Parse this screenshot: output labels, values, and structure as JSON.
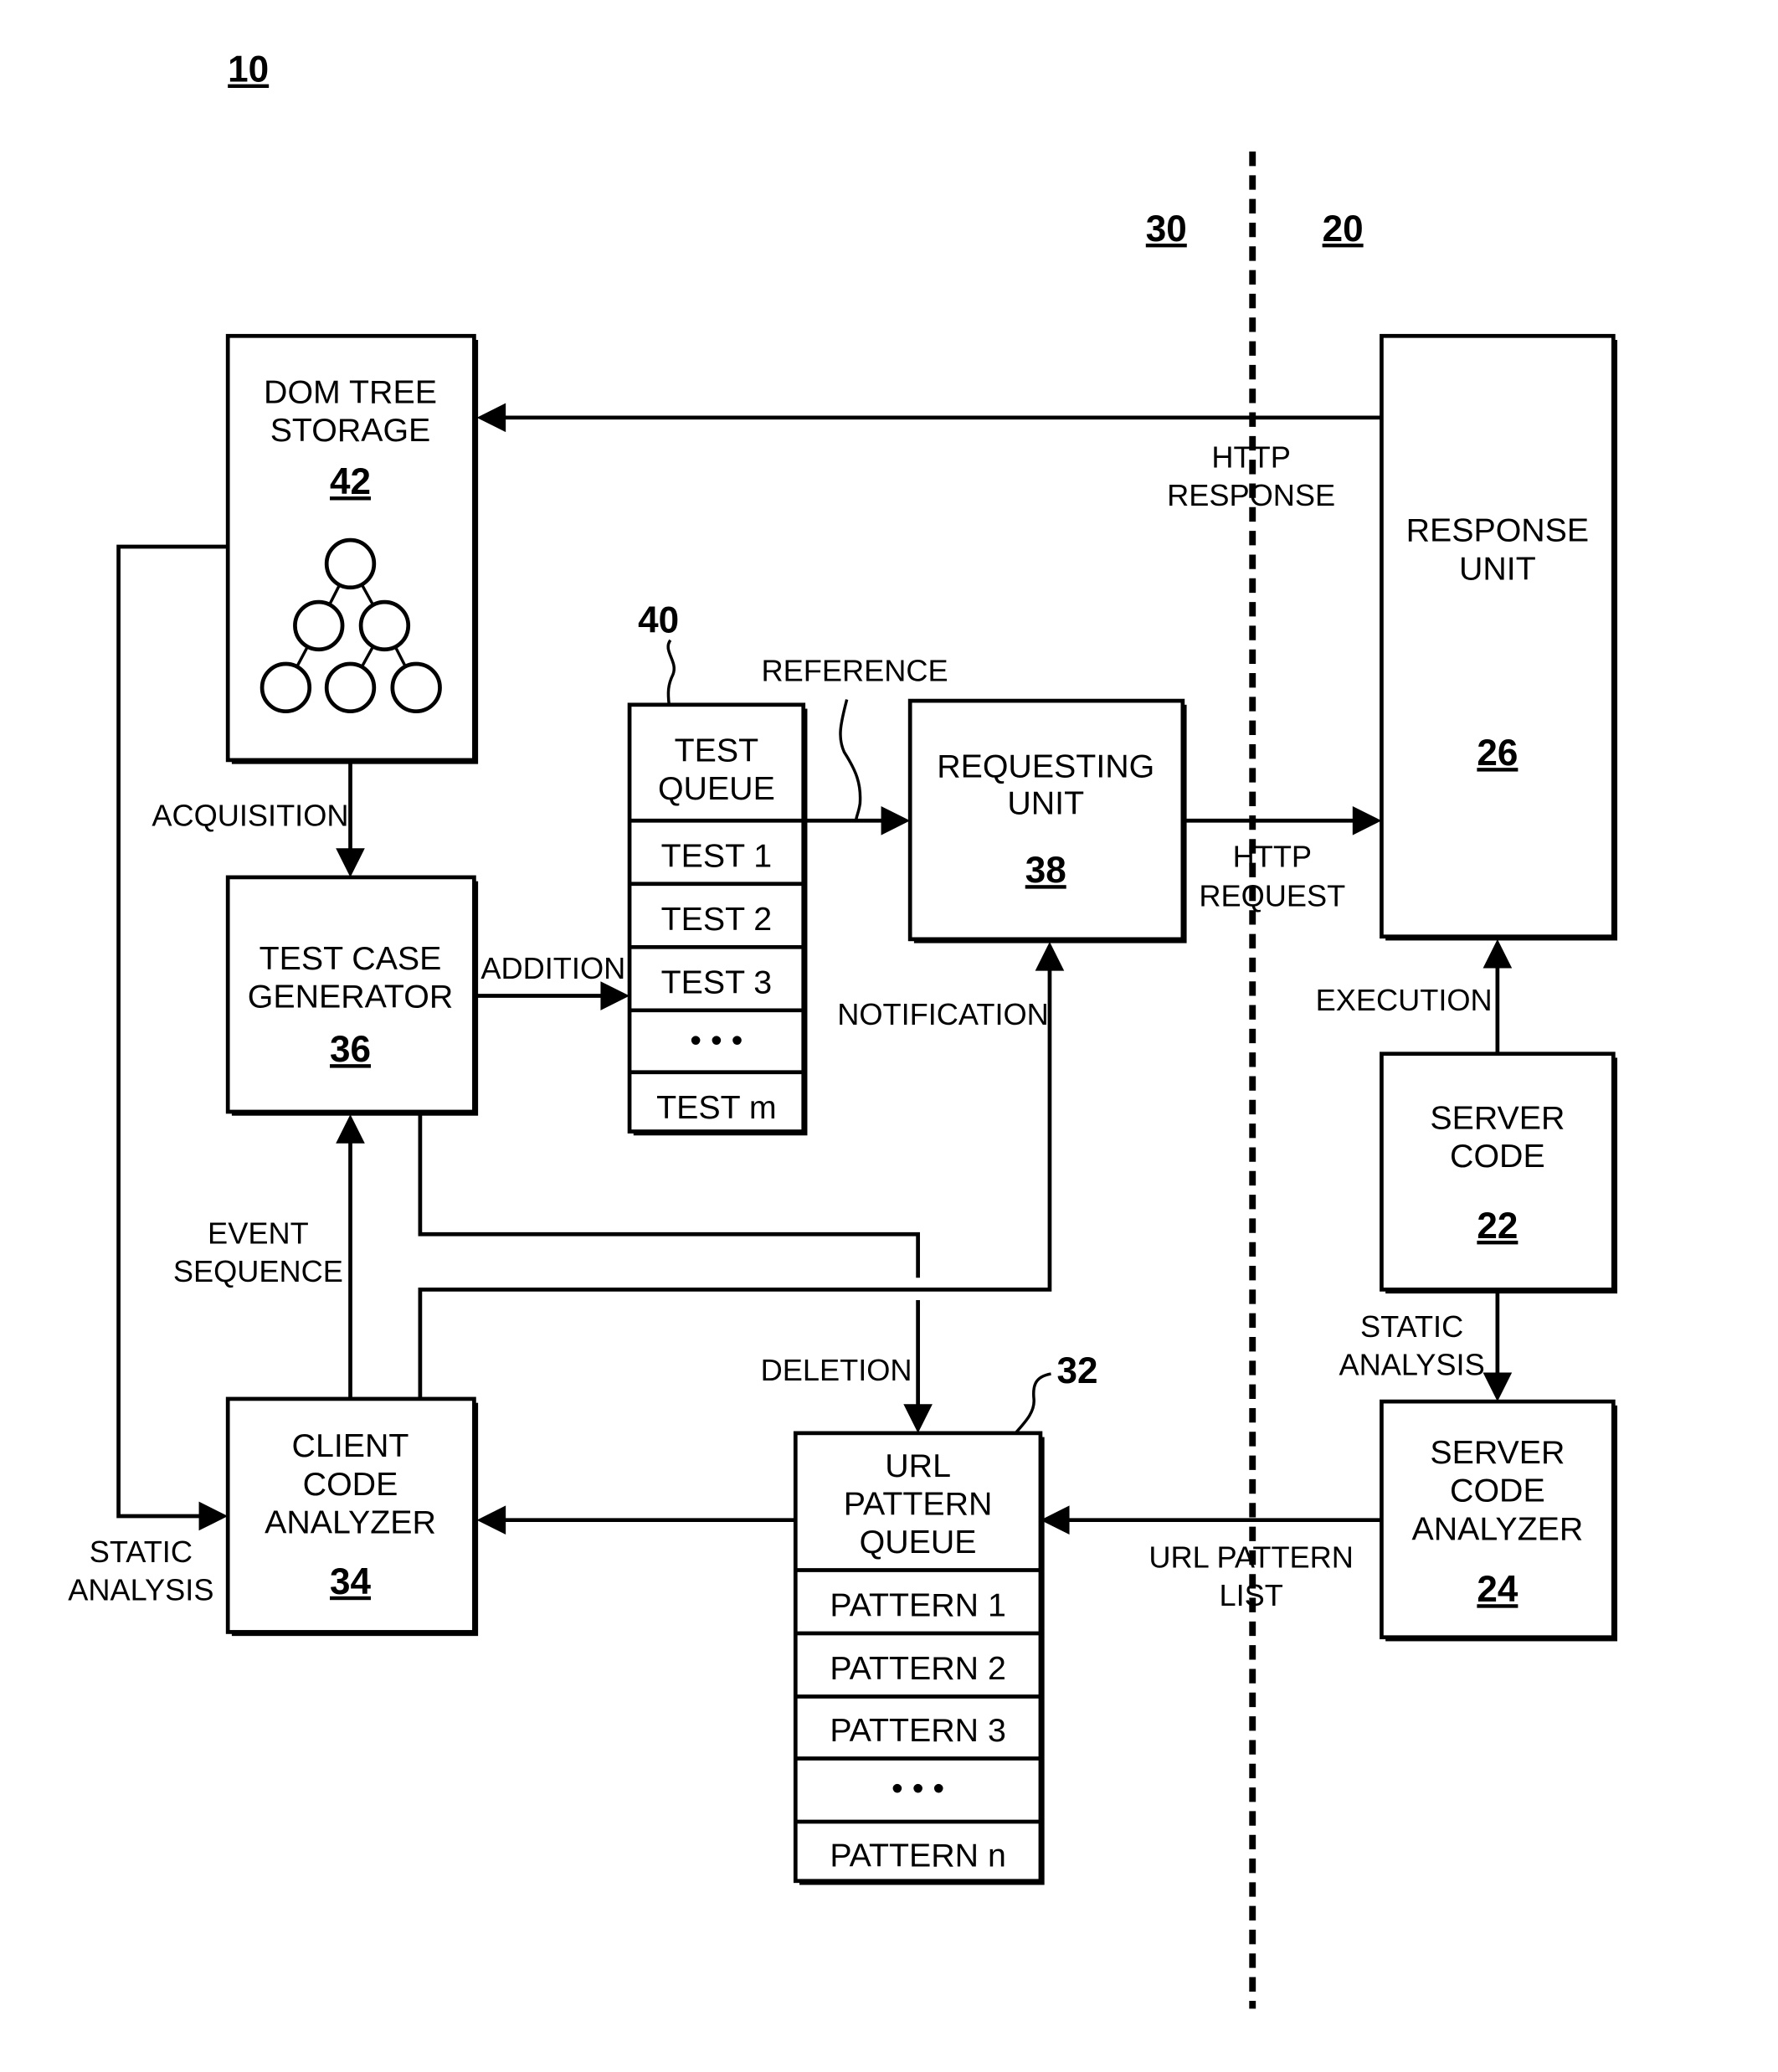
{
  "figure": {
    "ref_system": "10",
    "ref_server_side": "20",
    "ref_client_side": "30"
  },
  "blocks": {
    "dom_tree_storage": {
      "lines": [
        "DOM TREE",
        "STORAGE"
      ],
      "ref": "42"
    },
    "response_unit": {
      "lines": [
        "RESPONSE",
        "UNIT"
      ],
      "ref": "26"
    },
    "test_queue": {
      "lines": [
        "TEST",
        "QUEUE"
      ],
      "ref": "40",
      "items": [
        "TEST 1",
        "TEST 2",
        "TEST 3",
        "• • •",
        "TEST m"
      ]
    },
    "requesting_unit": {
      "lines": [
        "REQUESTING",
        "UNIT"
      ],
      "ref": "38"
    },
    "test_case_generator": {
      "lines": [
        "TEST CASE",
        "GENERATOR"
      ],
      "ref": "36"
    },
    "server_code": {
      "lines": [
        "SERVER",
        "CODE"
      ],
      "ref": "22"
    },
    "client_code_analyzer": {
      "lines": [
        "CLIENT",
        "CODE",
        "ANALYZER"
      ],
      "ref": "34"
    },
    "url_pattern_queue": {
      "lines": [
        "URL",
        "PATTERN",
        "QUEUE"
      ],
      "ref": "32",
      "items": [
        "PATTERN 1",
        "PATTERN 2",
        "PATTERN 3",
        "• • •",
        "PATTERN n"
      ]
    },
    "server_code_analyzer": {
      "lines": [
        "SERVER",
        "CODE",
        "ANALYZER"
      ],
      "ref": "24"
    }
  },
  "edges": {
    "http_response": [
      "HTTP",
      "RESPONSE"
    ],
    "reference": "REFERENCE",
    "http_request": [
      "HTTP",
      "REQUEST"
    ],
    "acquisition": "ACQUISITION",
    "addition": "ADDITION",
    "notification": "NOTIFICATION",
    "execution": "EXECUTION",
    "event_sequence": [
      "EVENT",
      "SEQUENCE"
    ],
    "deletion": "DELETION",
    "static_analysis_server": [
      "STATIC",
      "ANALYSIS"
    ],
    "static_analysis_client": [
      "STATIC",
      "ANALYSIS"
    ],
    "url_pattern_list": [
      "URL PATTERN",
      "LIST"
    ]
  }
}
